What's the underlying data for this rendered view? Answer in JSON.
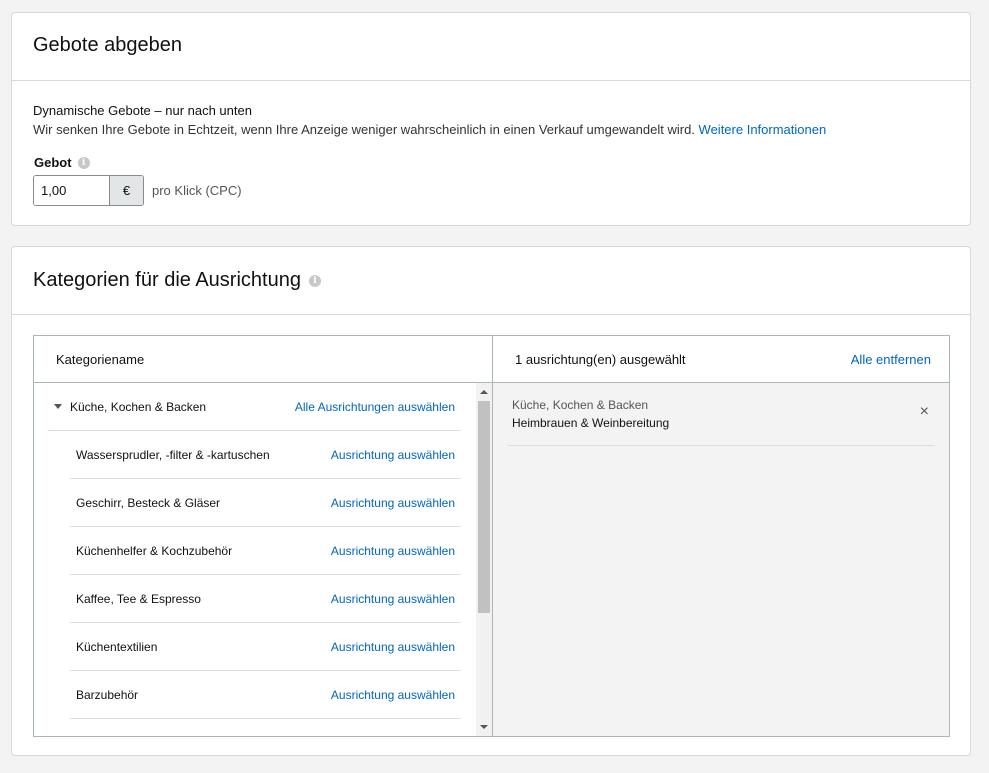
{
  "bids": {
    "title": "Gebote abgeben",
    "dynamic_title": "Dynamische Gebote – nur nach unten",
    "dynamic_desc": "Wir senken Ihre Gebote in Echtzeit, wenn Ihre Anzeige weniger wahrscheinlich in einen Verkauf umgewandelt wird.",
    "more_info": "Weitere Informationen",
    "bid_label": "Gebot",
    "bid_value": "1,00",
    "currency": "€",
    "per_click": "pro Klick (CPC)"
  },
  "categories": {
    "title": "Kategorien für die Ausrichtung",
    "column_name": "Kategoriename",
    "selected_count": "1 ausrichtung(en) ausgewählt",
    "remove_all": "Alle entfernen",
    "parent": {
      "name": "Küche, Kochen & Backen",
      "action": "Alle Ausrichtungen auswählen"
    },
    "children": [
      {
        "name": "Wassersprudler, -filter & -kartuschen",
        "action": "Ausrichtung auswählen"
      },
      {
        "name": "Geschirr, Besteck & Gläser",
        "action": "Ausrichtung auswählen"
      },
      {
        "name": "Küchenhelfer & Kochzubehör",
        "action": "Ausrichtung auswählen"
      },
      {
        "name": "Kaffee, Tee & Espresso",
        "action": "Ausrichtung auswählen"
      },
      {
        "name": "Küchentextilien",
        "action": "Ausrichtung auswählen"
      },
      {
        "name": "Barzubehör",
        "action": "Ausrichtung auswählen"
      }
    ],
    "selected": [
      {
        "parent": "Küche, Kochen & Backen",
        "name": "Heimbrauen & Weinbereitung",
        "remove_icon": "×"
      }
    ]
  },
  "icons": {
    "info": "i"
  }
}
